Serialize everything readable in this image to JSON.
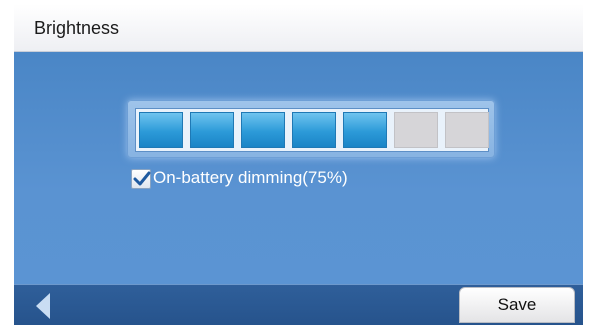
{
  "header": {
    "title": "Brightness"
  },
  "brightness": {
    "segments_total": 7,
    "segments_on": 5
  },
  "option": {
    "label": "On-battery dimming(75%)",
    "checked": true
  },
  "footer": {
    "back_icon": "back-arrow-icon",
    "save_label": "Save"
  },
  "colors": {
    "accent": "#4a86c6",
    "segment_on": "#2c9ad8",
    "segment_off": "#d6d5d8"
  }
}
